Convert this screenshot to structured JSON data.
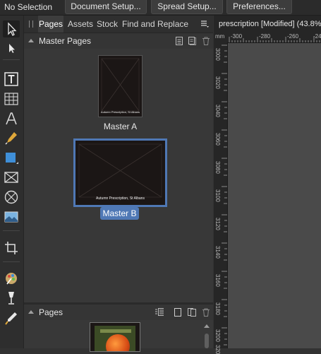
{
  "context_toolbar": {
    "selection_label": "No Selection",
    "buttons": [
      "Document Setup...",
      "Spread Setup...",
      "Preferences..."
    ]
  },
  "tools": [
    "move-tool",
    "node-tool",
    "frame-text-tool",
    "table-tool",
    "artistic-text-tool",
    "pen-tool",
    "shape-tool",
    "picture-frame-tool",
    "ellipse-frame-tool",
    "place-image-tool",
    "crop-tool",
    "color-picker-tool",
    "fill-tool",
    "transparency-tool"
  ],
  "panel": {
    "tabs": [
      "Pages",
      "Assets",
      "Stock",
      "Find and Replace"
    ],
    "active_tab": "Pages",
    "master_pages_title": "Master Pages",
    "masters": [
      {
        "name": "Master A",
        "thumb_text": "Autumn Prescription, St Albans",
        "selected": false
      },
      {
        "name": "Master B",
        "thumb_text": "Autumn Prescription, St Albans",
        "selected": true
      }
    ],
    "pages_title": "Pages"
  },
  "document": {
    "tab_title": "prescription [Modified] (43.8%",
    "ruler_unit": "mm",
    "ruler_h_labels": [
      "-300",
      "-280",
      "-260",
      "-24"
    ],
    "ruler_v_labels": [
      "3000",
      "3020",
      "3040",
      "3060",
      "3080",
      "3100",
      "3120",
      "3140",
      "3160",
      "3180",
      "3200",
      "320"
    ]
  },
  "colors": {
    "selection_accent": "#4f78b5",
    "background": "#323232"
  }
}
